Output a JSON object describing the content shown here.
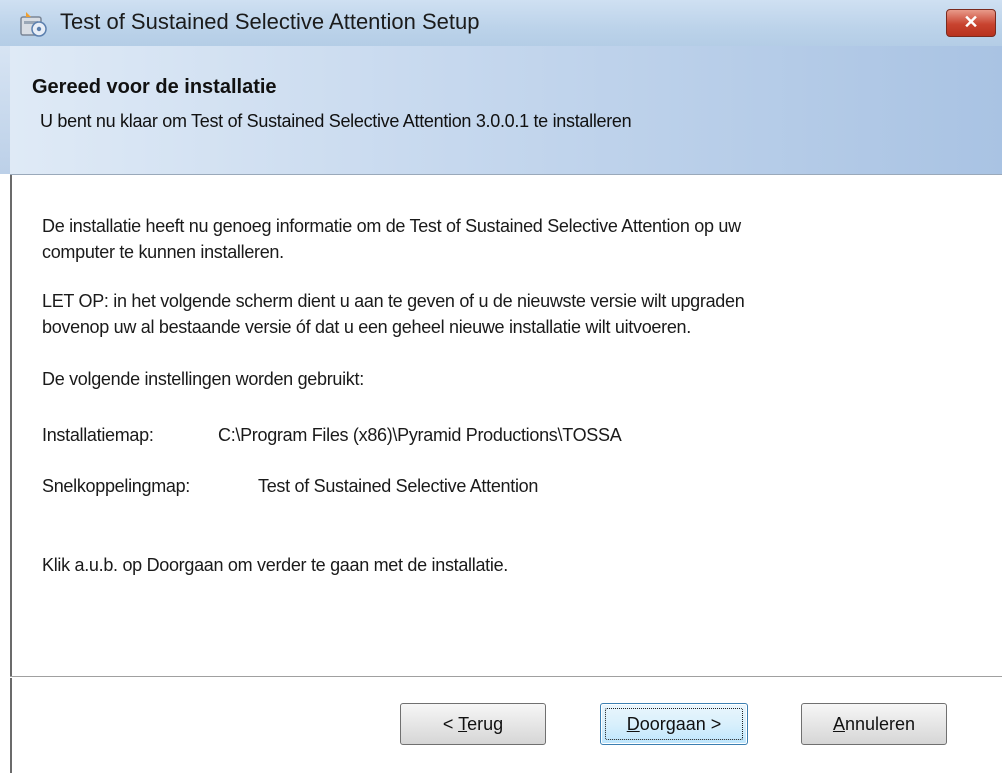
{
  "window": {
    "title": "Test of Sustained Selective Attention Setup",
    "close_label": "✕"
  },
  "header": {
    "title": "Gereed voor de installatie",
    "subtitle": "U bent nu klaar om Test of Sustained Selective Attention 3.0.0.1 te installeren"
  },
  "body": {
    "para1_line1": "De installatie heeft nu genoeg informatie om de Test of Sustained Selective Attention op uw",
    "para1_line2": "computer te kunnen installeren.",
    "para2_line1": "LET OP: in het volgende scherm dient u aan te geven of u de nieuwste versie wilt upgraden",
    "para2_line2": "bovenop uw al bestaande versie óf dat u een geheel nieuwe installatie wilt uitvoeren.",
    "settings_intro": "De volgende instellingen worden gebruikt:",
    "install_dir_label": "Installatiemap:",
    "install_dir_value": "C:\\Program Files (x86)\\Pyramid Productions\\TOSSA",
    "shortcut_label": "Snelkoppelingmap:",
    "shortcut_value": "Test of Sustained Selective Attention",
    "continue_hint": "Klik a.u.b. op Doorgaan om verder te gaan met de installatie."
  },
  "buttons": {
    "back_prefix": "< ",
    "back_mnemonic": "T",
    "back_rest": "erug",
    "next_mnemonic": "D",
    "next_rest": "oorgaan >",
    "cancel_mnemonic": "A",
    "cancel_rest": "nnuleren"
  },
  "icons": {
    "app": "installer-icon",
    "close": "close-icon"
  }
}
